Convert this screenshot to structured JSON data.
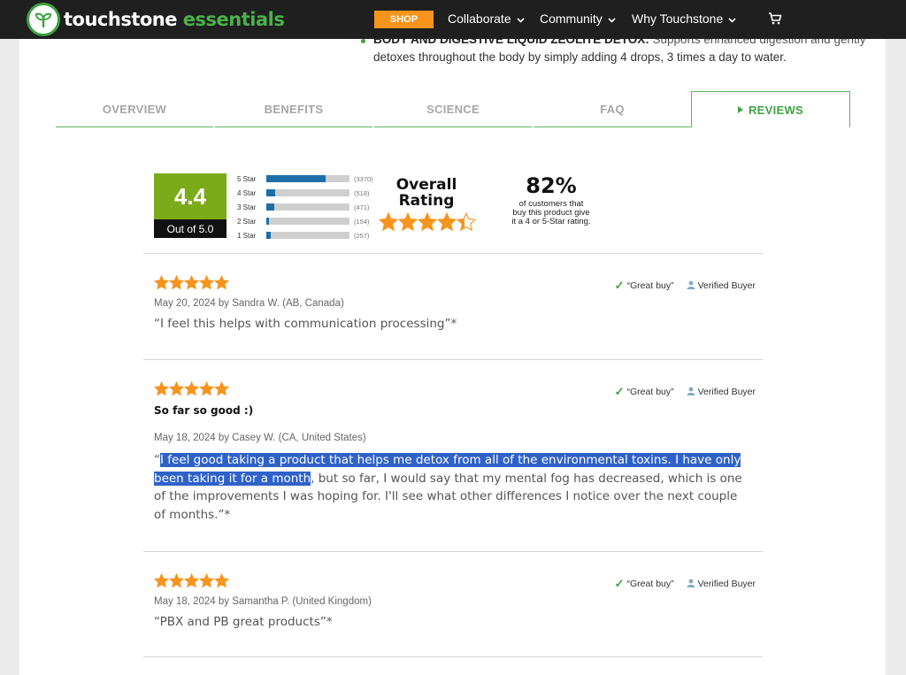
{
  "header": {
    "logo_white": "touchstone",
    "logo_green": "essentials",
    "shop_label": "SHOP",
    "nav": [
      {
        "label": "Collaborate"
      },
      {
        "label": "Community"
      },
      {
        "label": "Why Touchstone"
      }
    ],
    "cart_icon": "cart-icon"
  },
  "intro": {
    "bold": "BODY AND DIGESTIVE LIQUID ZEOLITE DETOX:",
    "line1_rest": " Supports enhanced digestion and gently",
    "line2": "detoxes throughout the body by simply adding 4 drops, 3 times a day to water."
  },
  "tabs": [
    {
      "label": "OVERVIEW"
    },
    {
      "label": "BENEFITS"
    },
    {
      "label": "SCIENCE"
    },
    {
      "label": "FAQ"
    },
    {
      "label": "REVIEWS"
    }
  ],
  "summary": {
    "score": "4.4",
    "out_of": "Out of 5.0",
    "breakdown": [
      {
        "label": "5 Star",
        "count": "(3370)",
        "fraction": 0.71
      },
      {
        "label": "4 Star",
        "count": "(518)",
        "fraction": 0.11
      },
      {
        "label": "3 Star",
        "count": "(471)",
        "fraction": 0.1
      },
      {
        "label": "2 Star",
        "count": "(154)",
        "fraction": 0.03
      },
      {
        "label": "1 Star",
        "count": "(257)",
        "fraction": 0.05
      }
    ],
    "overall_line1": "Overall",
    "overall_line2": "Rating",
    "overall_stars": 4.4,
    "percent": "82%",
    "percent_line1": "of customers that",
    "percent_line2": "buy this product give",
    "percent_line3": "it a 4 or 5-Star rating."
  },
  "reviews": [
    {
      "rating": 5,
      "badge_great": "“Great buy”",
      "badge_verified": "Verified Buyer",
      "title": "",
      "meta": "May 20, 2024 by Sandra W. (AB, Canada)",
      "body": "“I feel this helps with communication processing”*"
    },
    {
      "rating": 5,
      "badge_great": "“Great buy”",
      "badge_verified": "Verified Buyer",
      "title": "So far so good :)",
      "meta": "May 18, 2024 by Casey W. (CA, United States)",
      "body_open_quote": "“",
      "body_sel_1": "I feel good taking a product that helps me detox from all of the environmental toxins. I have only",
      "body_sel_2": "been taking it for a month",
      "body_rest_2": ", but so far, I would say that my mental fog has decreased, which is one",
      "body_line_3": "of the improvements I was hoping for. I'll see what other differences I notice over the next couple",
      "body_line_4": "of months.”*"
    },
    {
      "rating": 5,
      "badge_great": "“Great buy”",
      "badge_verified": "Verified Buyer",
      "title": "",
      "meta": "May 18, 2024 by Samantha P. (United Kingdom)",
      "body": "“PBX and PB great products”*"
    }
  ],
  "colors": {
    "brand_green": "#49b24a",
    "shop_orange": "#f7941d",
    "star_orange": "#f7941d",
    "score_green": "#7cab1a",
    "bar_blue": "#1e6fa8",
    "selection_blue": "#2f62c8"
  }
}
